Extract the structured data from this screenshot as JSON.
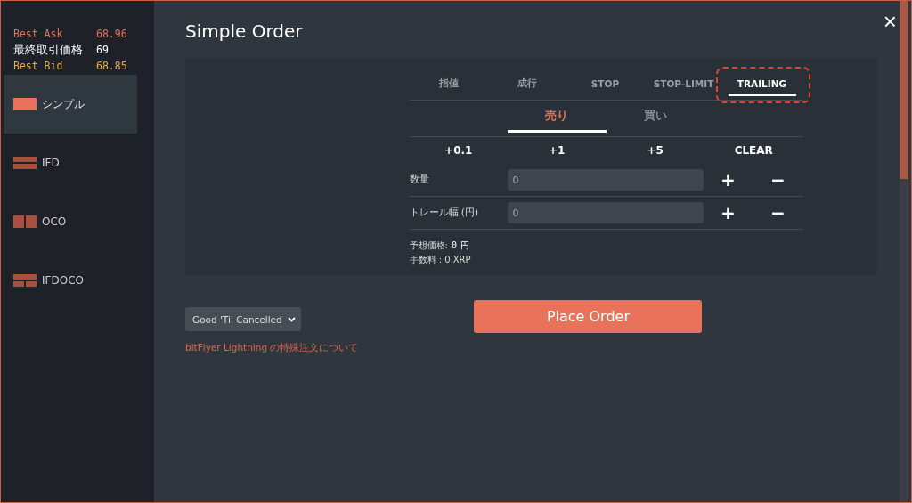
{
  "ticker": [
    {
      "kind": "ask",
      "label": "Best Ask",
      "value": "68.96"
    },
    {
      "kind": "last",
      "label": "最終取引価格",
      "value": "69"
    },
    {
      "kind": "bid",
      "label": "Best Bid",
      "value": "68.85"
    }
  ],
  "sidebar": {
    "items": [
      {
        "kind": "single",
        "label": "シンプル",
        "selected": true
      },
      {
        "kind": "ifd",
        "label": "IFD",
        "selected": false
      },
      {
        "kind": "oco",
        "label": "OCO",
        "selected": false
      },
      {
        "kind": "ifdoco",
        "label": "IFDOCO",
        "selected": false
      }
    ]
  },
  "dialog": {
    "title": "Simple Order",
    "close": "×"
  },
  "order_types": [
    {
      "label": "指値",
      "selected": false,
      "highlighted": false
    },
    {
      "label": "成行",
      "selected": false,
      "highlighted": false
    },
    {
      "label": "STOP",
      "selected": false,
      "highlighted": false
    },
    {
      "label": "STOP-LIMIT",
      "selected": false,
      "highlighted": false
    },
    {
      "label": "TRAILING",
      "selected": true,
      "highlighted": true
    }
  ],
  "sides": [
    {
      "label": "売り",
      "selected": true
    },
    {
      "label": "買い",
      "selected": false
    }
  ],
  "quick_buttons": [
    "+0.1",
    "+1",
    "+5",
    "CLEAR"
  ],
  "fields": [
    {
      "label": "数量",
      "placeholder": "0",
      "plus": "+",
      "minus": "−"
    },
    {
      "label": "トレール幅 (円)",
      "placeholder": "0",
      "plus": "+",
      "minus": "−"
    }
  ],
  "estimate": {
    "label": "予想価格:",
    "value": "0",
    "unit": "円"
  },
  "fee": "手数料 : 0 XRP",
  "time_in_force": {
    "value": "Good 'Til Cancelled"
  },
  "place_order": "Place Order",
  "help_link": "bitFlyer Lightning の特殊注文について"
}
